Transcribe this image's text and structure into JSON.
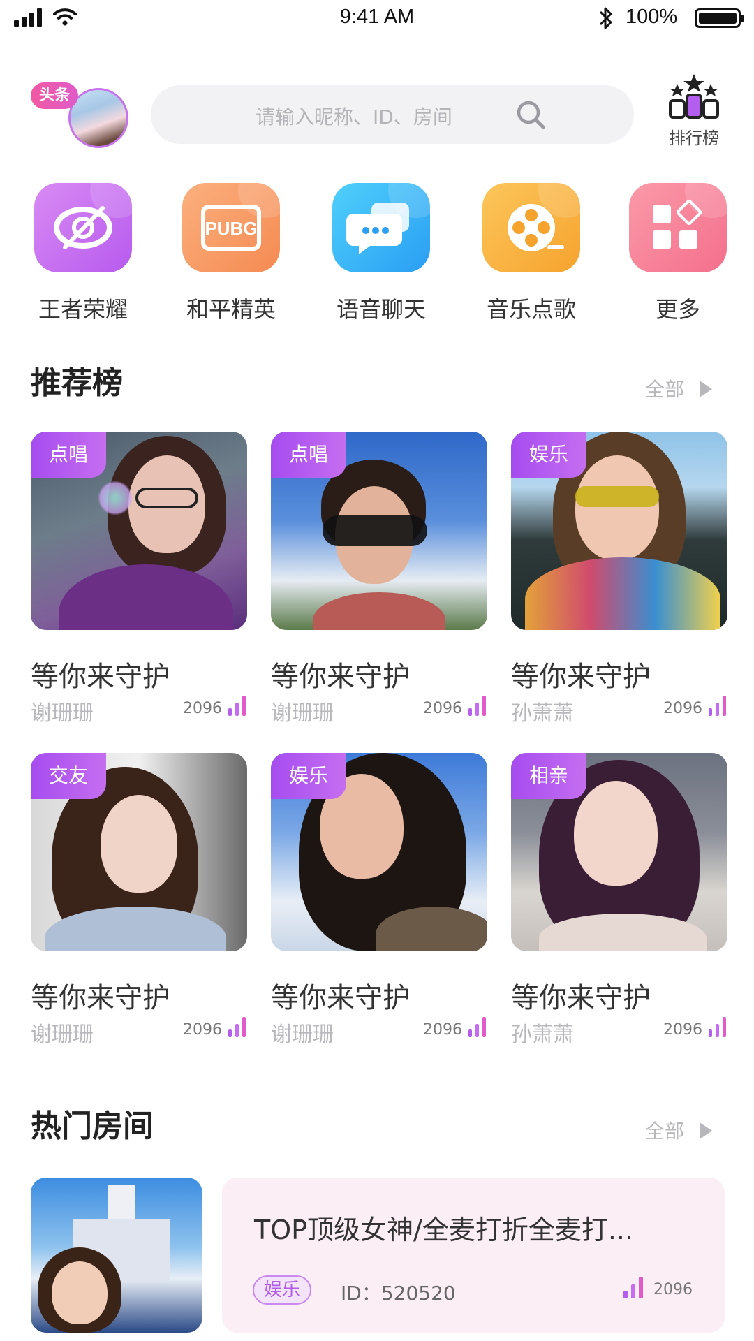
{
  "status_bar": {
    "time": "9:41 AM",
    "battery": "100%"
  },
  "header": {
    "avatar_badge": "头条",
    "search_placeholder": "请输入昵称、ID、房间",
    "rank_label": "排行榜"
  },
  "categories": [
    {
      "label": "王者荣耀",
      "icon": "game-eye-icon",
      "color": "#c468f0"
    },
    {
      "label": "和平精英",
      "icon": "pubg-icon",
      "color": "#f79a63"
    },
    {
      "label": "语音聊天",
      "icon": "chat-bubbles-icon",
      "color": "#3ab6f5"
    },
    {
      "label": "音乐点歌",
      "icon": "film-reel-icon",
      "color": "#f9b53f"
    },
    {
      "label": "更多",
      "icon": "grid-more-icon",
      "color": "#f77e94"
    }
  ],
  "recommend": {
    "title": "推荐榜",
    "more": "全部",
    "cards": [
      {
        "tag": "点唱",
        "title": "等你来守护",
        "host": "谢珊珊",
        "count": "2096"
      },
      {
        "tag": "点唱",
        "title": "等你来守护",
        "host": "谢珊珊",
        "count": "2096"
      },
      {
        "tag": "娱乐",
        "title": "等你来守护",
        "host": "孙萧萧",
        "count": "2096"
      },
      {
        "tag": "交友",
        "title": "等你来守护",
        "host": "谢珊珊",
        "count": "2096"
      },
      {
        "tag": "娱乐",
        "title": "等你来守护",
        "host": "谢珊珊",
        "count": "2096"
      },
      {
        "tag": "相亲",
        "title": "等你来守护",
        "host": "孙萧萧",
        "count": "2096"
      }
    ]
  },
  "hot_rooms": {
    "title": "热门房间",
    "more": "全部",
    "rooms": [
      {
        "title": "TOP顶级女神/全麦打折全麦打...",
        "tag": "娱乐",
        "id": "ID：520520",
        "count": "2096"
      }
    ]
  },
  "colors": {
    "accent": "#b45ef0",
    "badge": "#ee5aa8",
    "muted": "#b8b8bc"
  }
}
